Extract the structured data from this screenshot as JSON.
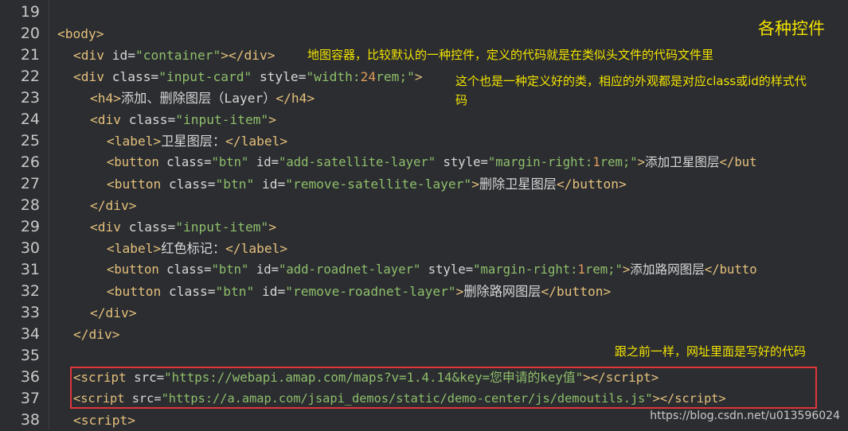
{
  "editor": {
    "line_numbers": [
      "19",
      "20",
      "21",
      "22",
      "23",
      "24",
      "25",
      "26",
      "27",
      "28",
      "29",
      "30",
      "31",
      "32",
      "33",
      "34",
      "35",
      "36",
      "37",
      "38"
    ],
    "lines": {
      "l20": [
        "<",
        "body",
        ">"
      ],
      "l21": [
        "<",
        "div",
        " ",
        "id",
        "=",
        "\"container\"",
        "><",
        "/",
        "div",
        ">"
      ],
      "l22": [
        "<",
        "div",
        " ",
        "class",
        "=",
        "\"input-card\"",
        " ",
        "style",
        "=",
        "\"width:",
        "24",
        "rem;\"",
        ">"
      ],
      "l23": [
        "<",
        "h4",
        ">",
        "添加、删除图层（Layer）",
        "</",
        "h4",
        ">"
      ],
      "l24": [
        "<",
        "div",
        " ",
        "class",
        "=",
        "\"input-item\"",
        ">"
      ],
      "l25": [
        "<",
        "label",
        ">",
        "卫星图层：",
        "</",
        "label",
        ">"
      ],
      "l26": [
        "<",
        "button",
        " ",
        "class",
        "=",
        "\"btn\"",
        " ",
        "id",
        "=",
        "\"add-satellite-layer\"",
        " ",
        "style",
        "=",
        "\"margin-right:",
        "1",
        "rem;\"",
        ">",
        "添加卫星图层",
        "</but"
      ],
      "l27": [
        "<",
        "button",
        " ",
        "class",
        "=",
        "\"btn\"",
        " ",
        "id",
        "=",
        "\"remove-satellite-layer\"",
        ">",
        "删除卫星图层",
        "</",
        "button",
        ">"
      ],
      "l28": [
        "</",
        "div",
        ">"
      ],
      "l29": [
        "<",
        "div",
        " ",
        "class",
        "=",
        "\"input-item\"",
        ">"
      ],
      "l30": [
        "<",
        "label",
        ">",
        "红色标记：",
        "</",
        "label",
        ">"
      ],
      "l31": [
        "<",
        "button",
        " ",
        "class",
        "=",
        "\"btn\"",
        " ",
        "id",
        "=",
        "\"add-roadnet-layer\"",
        " ",
        "style",
        "=",
        "\"margin-right:",
        "1",
        "rem;\"",
        ">",
        "添加路网图层",
        "</butto"
      ],
      "l32": [
        "<",
        "button",
        " ",
        "class",
        "=",
        "\"btn\"",
        " ",
        "id",
        "=",
        "\"remove-roadnet-layer\"",
        ">",
        "删除路网图层",
        "</",
        "button",
        ">"
      ],
      "l33": [
        "</",
        "div",
        ">"
      ],
      "l34": [
        "</",
        "div",
        ">"
      ],
      "l36": [
        "<",
        "script",
        " ",
        "src",
        "=",
        "\"https://webapi.amap.com/maps?v=1.4.14&key=您申请的key值\"",
        "></",
        "script",
        ">"
      ],
      "l37": [
        "<",
        "script",
        " ",
        "src",
        "=",
        "\"https://a.amap.com/jsapi_demos/static/demo-center/js/demoutils.js\"",
        "></",
        "script",
        ">"
      ],
      "l38": [
        "<",
        "script",
        ">"
      ]
    }
  },
  "annotations": {
    "title": "各种控件",
    "container_note": "地图容器，比较默认的一种控件，定义的代码就是在类似头文件的代码文件里",
    "input_card_note_1": "这个也是一种定义好的类，相应的外观都是对应class或id的样式代",
    "input_card_note_2": "码",
    "script_note": "跟之前一样，网址里面是写好的代码"
  },
  "watermark": "https://blog.csdn.net/u013596024",
  "colors": {
    "background": "#2b2d31",
    "tag": "#e5c07b",
    "string": "#8fbf6a",
    "number": "#e09b5b",
    "annotation": "#f2e200",
    "highlight_box": "#e0353a"
  }
}
